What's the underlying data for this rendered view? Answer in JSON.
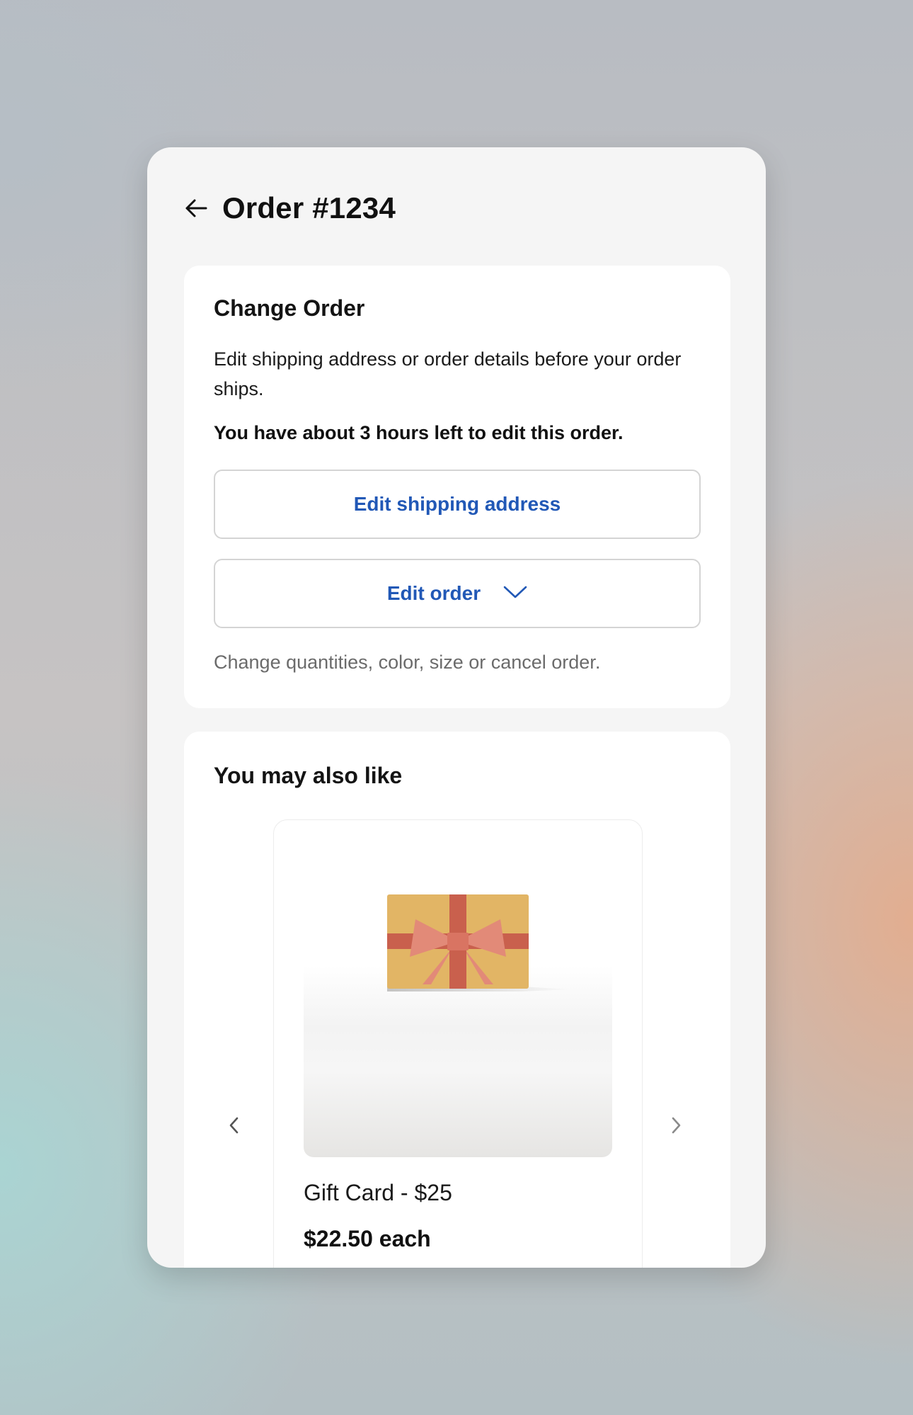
{
  "header": {
    "title": "Order #1234",
    "back_icon": "arrow-left-icon"
  },
  "change_order": {
    "title": "Change Order",
    "description": "Edit shipping address or order details before your order ships.",
    "warning": "You have about 3 hours left to edit this order.",
    "edit_shipping_label": "Edit shipping address",
    "edit_order_label": "Edit order",
    "edit_order_icon": "chevron-down-icon",
    "hint": "Change quantities, color, size or cancel order."
  },
  "recommendations": {
    "title": "You may also like",
    "prev_icon": "chevron-left-icon",
    "next_icon": "chevron-right-icon",
    "items": [
      {
        "name": "Gift Card - $25",
        "price": "$22.50 each",
        "image_icon": "gift-card-icon"
      }
    ]
  },
  "colors": {
    "accent": "#2158b6",
    "panel_bg": "#f5f5f5",
    "card_bg": "#ffffff",
    "muted_text": "#6b6b6b",
    "gift_card": "#e2b565",
    "gift_ribbon": "#c9604d",
    "gift_bow": "#e28a78"
  }
}
